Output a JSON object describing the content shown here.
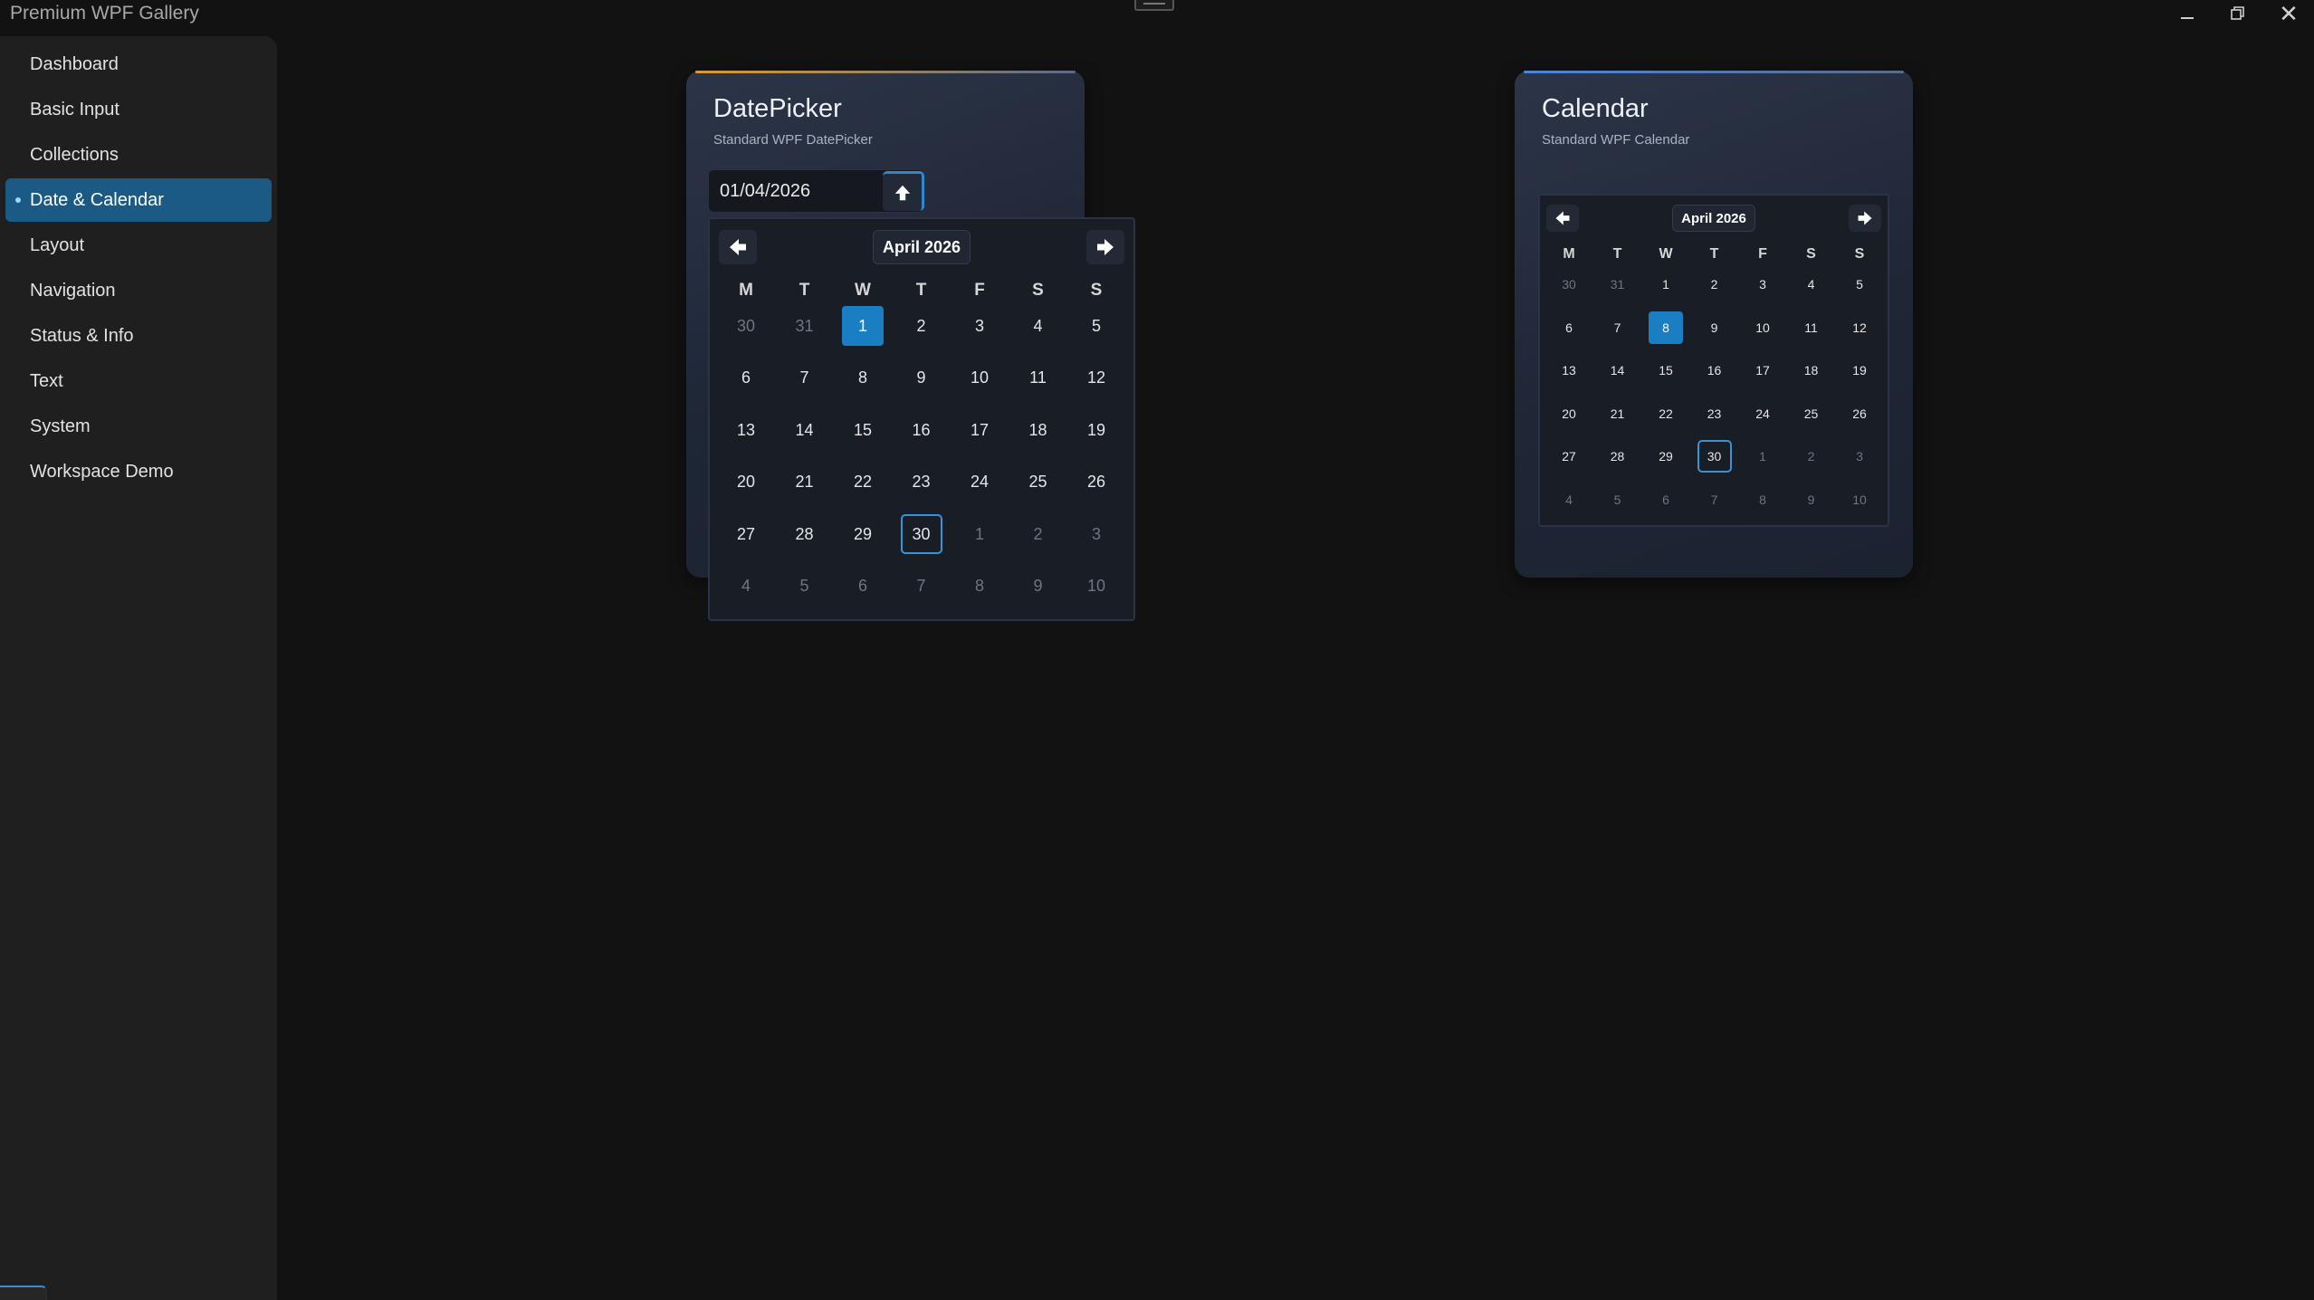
{
  "app": {
    "title": "Premium WPF Gallery"
  },
  "window_controls": {
    "close_glyph": "✕"
  },
  "sidebar": {
    "items": [
      {
        "label": "Dashboard",
        "name": "sidebar-item-dashboard"
      },
      {
        "label": "Basic Input",
        "name": "sidebar-item-basic-input"
      },
      {
        "label": "Collections",
        "name": "sidebar-item-collections"
      },
      {
        "label": "Date & Calendar",
        "name": "sidebar-item-date-calendar",
        "active": true
      },
      {
        "label": "Layout",
        "name": "sidebar-item-layout"
      },
      {
        "label": "Navigation",
        "name": "sidebar-item-navigation"
      },
      {
        "label": "Status & Info",
        "name": "sidebar-item-status-info"
      },
      {
        "label": "Text",
        "name": "sidebar-item-text"
      },
      {
        "label": "System",
        "name": "sidebar-item-system"
      },
      {
        "label": "Workspace Demo",
        "name": "sidebar-item-workspace-demo"
      }
    ],
    "settings_icon": "gear-icon"
  },
  "datepicker_card": {
    "title": "DatePicker",
    "subtitle": "Standard WPF DatePicker",
    "accent_color": "#d99a3a",
    "input_value": "01/04/2026",
    "toggle_icon": "arrow-up-icon"
  },
  "calendar_card": {
    "title": "Calendar",
    "subtitle": "Standard WPF Calendar",
    "accent_color": "#4a86d8"
  },
  "popup_calendar": {
    "month_label": "April 2026",
    "prev_icon": "arrow-left-icon",
    "next_icon": "arrow-right-icon",
    "weekdays": [
      "M",
      "T",
      "W",
      "T",
      "F",
      "S",
      "S"
    ],
    "weeks": [
      [
        "30",
        "31",
        "1",
        "2",
        "3",
        "4",
        "5"
      ],
      [
        "6",
        "7",
        "8",
        "9",
        "10",
        "11",
        "12"
      ],
      [
        "13",
        "14",
        "15",
        "16",
        "17",
        "18",
        "19"
      ],
      [
        "20",
        "21",
        "22",
        "23",
        "24",
        "25",
        "26"
      ],
      [
        "27",
        "28",
        "29",
        "30",
        "1",
        "2",
        "3"
      ],
      [
        "4",
        "5",
        "6",
        "7",
        "8",
        "9",
        "10"
      ]
    ],
    "selected_day": "1",
    "today_day": "30"
  },
  "standalone_calendar": {
    "month_label": "April 2026",
    "prev_icon": "arrow-left-icon",
    "next_icon": "arrow-right-icon",
    "weekdays": [
      "M",
      "T",
      "W",
      "T",
      "F",
      "S",
      "S"
    ],
    "weeks": [
      [
        "30",
        "31",
        "1",
        "2",
        "3",
        "4",
        "5"
      ],
      [
        "6",
        "7",
        "8",
        "9",
        "10",
        "11",
        "12"
      ],
      [
        "13",
        "14",
        "15",
        "16",
        "17",
        "18",
        "19"
      ],
      [
        "20",
        "21",
        "22",
        "23",
        "24",
        "25",
        "26"
      ],
      [
        "27",
        "28",
        "29",
        "30",
        "1",
        "2",
        "3"
      ],
      [
        "4",
        "5",
        "6",
        "7",
        "8",
        "9",
        "10"
      ]
    ],
    "selected_day": "8",
    "today_day": "30"
  },
  "colors": {
    "accent_blue": "#1a7fc2",
    "sidebar_active": "#1a5a85",
    "background": "#121212"
  }
}
